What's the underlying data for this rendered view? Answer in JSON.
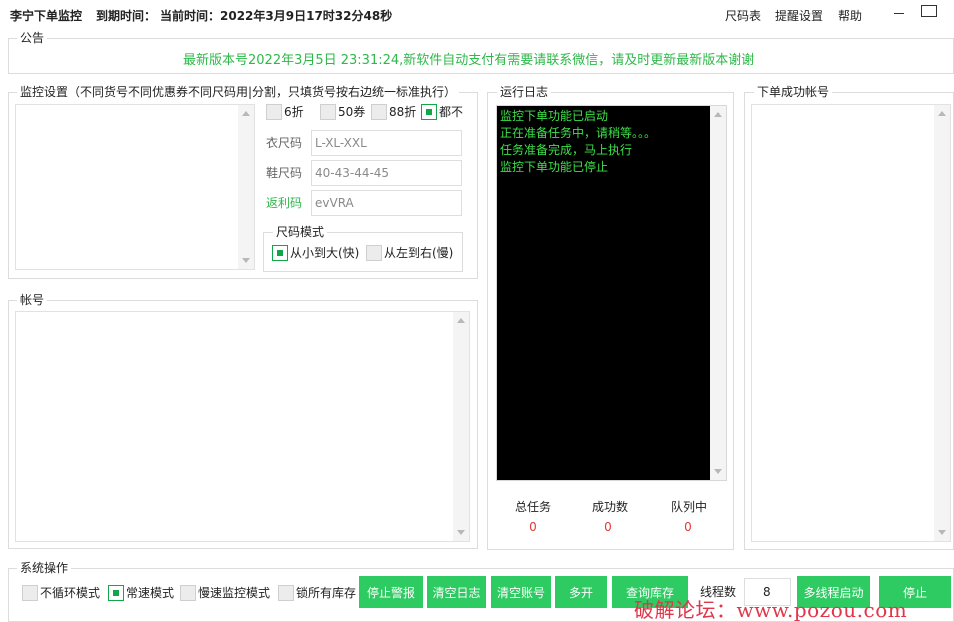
{
  "header": {
    "app_title": "李宁下单监控",
    "expiry_label": "到期时间：",
    "current_time_label": "当前时间：2022年3月9日17时32分48秒",
    "menu": [
      "尺码表",
      "提醒设置",
      "帮助"
    ]
  },
  "notice": {
    "legend": "公告",
    "text": "最新版本号2022年3月5日 23:31:24,新软件自动支付有需要请联系微信，请及时更新最新版本谢谢"
  },
  "monitor": {
    "legend": "监控设置（不同货号不同优惠券不同尺码用|分割，只填货号按右边统一标准执行）",
    "discounts": [
      {
        "label": "6折",
        "checked": false
      },
      {
        "label": "50券",
        "checked": false
      },
      {
        "label": "88折",
        "checked": false
      },
      {
        "label": "都不",
        "checked": true
      }
    ],
    "clothes_size_label": "衣尺码",
    "clothes_size_value": "L-XL-XXL",
    "shoe_size_label": "鞋尺码",
    "shoe_size_value": "40-43-44-45",
    "rebate_label": "返利码",
    "rebate_value": "evVRA",
    "size_mode": {
      "legend": "尺码模式",
      "options": [
        {
          "label": "从小到大(快)",
          "checked": true
        },
        {
          "label": "从左到右(慢)",
          "checked": false
        }
      ]
    }
  },
  "accounts": {
    "legend": "帐号"
  },
  "log": {
    "legend": "运行日志",
    "lines": [
      "监控下单功能已启动",
      "正在准备任务中，请稍等。。。",
      "任务准备完成，马上执行",
      "监控下单功能已停止"
    ],
    "stats": [
      {
        "label": "总任务",
        "value": "0"
      },
      {
        "label": "成功数",
        "value": "0"
      },
      {
        "label": "队列中",
        "value": "0"
      }
    ]
  },
  "success_accounts": {
    "legend": "下单成功帐号"
  },
  "system": {
    "legend": "系统操作",
    "modes": [
      {
        "label": "不循环模式",
        "checked": false
      },
      {
        "label": "常速模式",
        "checked": true
      },
      {
        "label": "慢速监控模式",
        "checked": false
      },
      {
        "label": "锁所有库存",
        "checked": false
      }
    ],
    "buttons": [
      "停止警报",
      "清空日志",
      "清空账号",
      "多开",
      "查询库存"
    ],
    "thread_label": "线程数",
    "thread_value": "8",
    "multi_start_label": "多线程启动",
    "stop_label": "停止"
  },
  "watermark": "破解论坛：www.pozou.com",
  "colors": {
    "accent": "#2ecb62",
    "notice_text": "#2fb84a",
    "log_text": "#3ee04a",
    "stat_value": "#e03a3a",
    "watermark": "#e0364a"
  }
}
